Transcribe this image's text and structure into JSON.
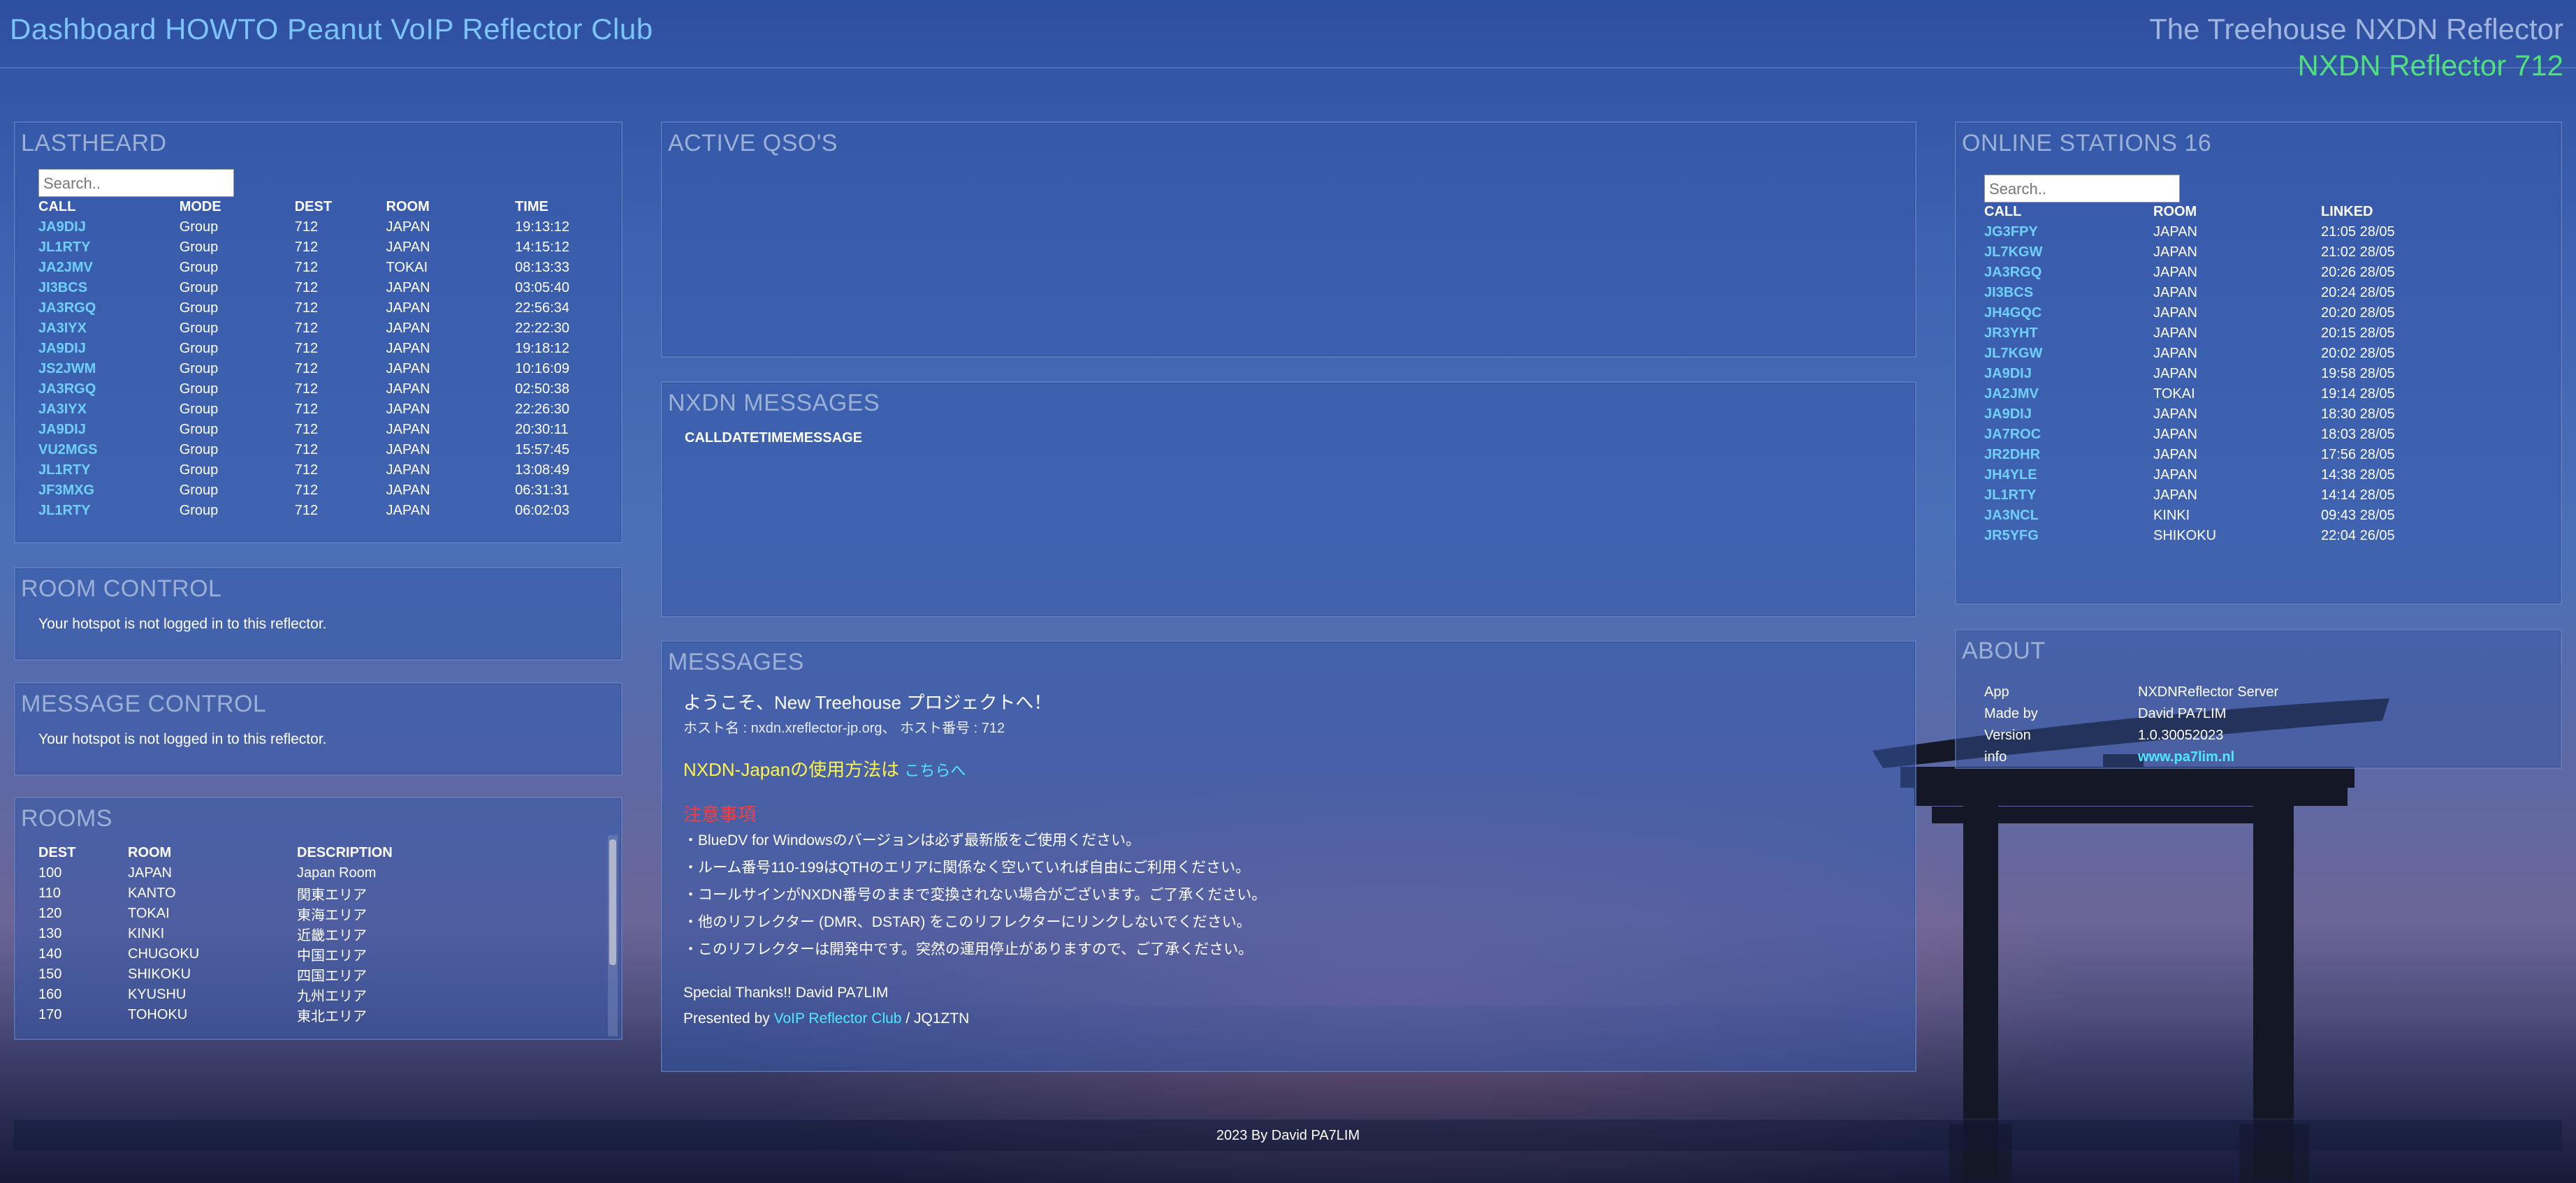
{
  "header": {
    "title": "Dashboard HOWTO Peanut VoIP Reflector Club",
    "right_line1": "The Treehouse NXDN Reflector",
    "right_line2": "NXDN Reflector 712"
  },
  "lastheard": {
    "title": "LASTHEARD",
    "search_placeholder": "Search..",
    "columns": [
      "CALL",
      "MODE",
      "DEST",
      "ROOM",
      "TIME"
    ],
    "rows": [
      [
        "JA9DIJ",
        "Group",
        "712",
        "JAPAN",
        "19:13:12"
      ],
      [
        "JL1RTY",
        "Group",
        "712",
        "JAPAN",
        "14:15:12"
      ],
      [
        "JA2JMV",
        "Group",
        "712",
        "TOKAI",
        "08:13:33"
      ],
      [
        "JI3BCS",
        "Group",
        "712",
        "JAPAN",
        "03:05:40"
      ],
      [
        "JA3RGQ",
        "Group",
        "712",
        "JAPAN",
        "22:56:34"
      ],
      [
        "JA3IYX",
        "Group",
        "712",
        "JAPAN",
        "22:22:30"
      ],
      [
        "JA9DIJ",
        "Group",
        "712",
        "JAPAN",
        "19:18:12"
      ],
      [
        "JS2JWM",
        "Group",
        "712",
        "JAPAN",
        "10:16:09"
      ],
      [
        "JA3RGQ",
        "Group",
        "712",
        "JAPAN",
        "02:50:38"
      ],
      [
        "JA3IYX",
        "Group",
        "712",
        "JAPAN",
        "22:26:30"
      ],
      [
        "JA9DIJ",
        "Group",
        "712",
        "JAPAN",
        "20:30:11"
      ],
      [
        "VU2MGS",
        "Group",
        "712",
        "JAPAN",
        "15:57:45"
      ],
      [
        "JL1RTY",
        "Group",
        "712",
        "JAPAN",
        "13:08:49"
      ],
      [
        "JF3MXG",
        "Group",
        "712",
        "JAPAN",
        "06:31:31"
      ],
      [
        "JL1RTY",
        "Group",
        "712",
        "JAPAN",
        "06:02:03"
      ]
    ]
  },
  "room_control": {
    "title": "ROOM CONTROL",
    "text": "Your hotspot is not logged in to this reflector."
  },
  "message_control": {
    "title": "MESSAGE CONTROL",
    "text": "Your hotspot is not logged in to this reflector."
  },
  "rooms": {
    "title": "ROOMS",
    "columns": [
      "DEST",
      "ROOM",
      "DESCRIPTION"
    ],
    "rows": [
      [
        "100",
        "JAPAN",
        "Japan Room"
      ],
      [
        "110",
        "KANTO",
        "関東エリア"
      ],
      [
        "120",
        "TOKAI",
        "東海エリア"
      ],
      [
        "130",
        "KINKI",
        "近畿エリア"
      ],
      [
        "140",
        "CHUGOKU",
        "中国エリア"
      ],
      [
        "150",
        "SHIKOKU",
        "四国エリア"
      ],
      [
        "160",
        "KYUSHU",
        "九州エリア"
      ],
      [
        "170",
        "TOHOKU",
        "東北エリア"
      ]
    ]
  },
  "active_qsos": {
    "title": "ACTIVE QSO'S"
  },
  "nxdn_messages": {
    "title": "NXDN MESSAGES",
    "header": "CALLDATETIMEMESSAGE"
  },
  "messages": {
    "title": "MESSAGES",
    "welcome": "ようこそ、New Treehouse プロジェクトへ！",
    "host": "ホスト名 : nxdn.xreflector-jp.org、 ホスト番号 : 712",
    "usage_prefix": "NXDN-Japanの使用方法は",
    "usage_link": "こちらへ",
    "notice_title": "注意事項",
    "notices": [
      "・BlueDV for Windowsのバージョンは必ず最新版をご使用ください。",
      "・ルーム番号110-199はQTHのエリアに関係なく空いていれば自由にご利用ください。",
      "・コールサインがNXDN番号のままで変換されない場合がございます。ご了承ください。",
      "・他のリフレクター (DMR、DSTAR) をこのリフレクターにリンクしないでください。",
      "・このリフレクターは開発中です。突然の運用停止がありますので、ご了承ください。"
    ],
    "thanks": "Special Thanks!! David PA7LIM",
    "presented_prefix": "Presented by",
    "presented_link": "VoIP Reflector Club",
    "presented_suffix": "/ JQ1ZTN"
  },
  "online": {
    "title": "ONLINE STATIONS 16",
    "search_placeholder": "Search..",
    "columns": [
      "CALL",
      "ROOM",
      "LINKED"
    ],
    "rows": [
      [
        "JG3FPY",
        "JAPAN",
        "21:05 28/05"
      ],
      [
        "JL7KGW",
        "JAPAN",
        "21:02 28/05"
      ],
      [
        "JA3RGQ",
        "JAPAN",
        "20:26 28/05"
      ],
      [
        "JI3BCS",
        "JAPAN",
        "20:24 28/05"
      ],
      [
        "JH4GQC",
        "JAPAN",
        "20:20 28/05"
      ],
      [
        "JR3YHT",
        "JAPAN",
        "20:15 28/05"
      ],
      [
        "JL7KGW",
        "JAPAN",
        "20:02 28/05"
      ],
      [
        "JA9DIJ",
        "JAPAN",
        "19:58 28/05"
      ],
      [
        "JA2JMV",
        "TOKAI",
        "19:14 28/05"
      ],
      [
        "JA9DIJ",
        "JAPAN",
        "18:30 28/05"
      ],
      [
        "JA7ROC",
        "JAPAN",
        "18:03 28/05"
      ],
      [
        "JR2DHR",
        "JAPAN",
        "17:56 28/05"
      ],
      [
        "JH4YLE",
        "JAPAN",
        "14:38 28/05"
      ],
      [
        "JL1RTY",
        "JAPAN",
        "14:14 28/05"
      ],
      [
        "JA3NCL",
        "KINKI",
        "09:43 28/05"
      ],
      [
        "JR5YFG",
        "SHIKOKU",
        "22:04 26/05"
      ]
    ]
  },
  "about": {
    "title": "ABOUT",
    "rows": [
      [
        "App",
        "NXDNReflector Server"
      ],
      [
        "Made by",
        "David PA7LIM"
      ],
      [
        "Version",
        "1.0.30052023"
      ],
      [
        "info",
        "www.pa7lim.nl"
      ]
    ]
  },
  "footer": {
    "text": "2023 By David PA7LIM"
  },
  "colors": {
    "title_blue": "#7cc4ff",
    "reflector_green": "#4ee07a",
    "call_link": "#6fd0ff",
    "notice_red": "#ff3c3c",
    "usage_yellow": "#fff34a"
  }
}
